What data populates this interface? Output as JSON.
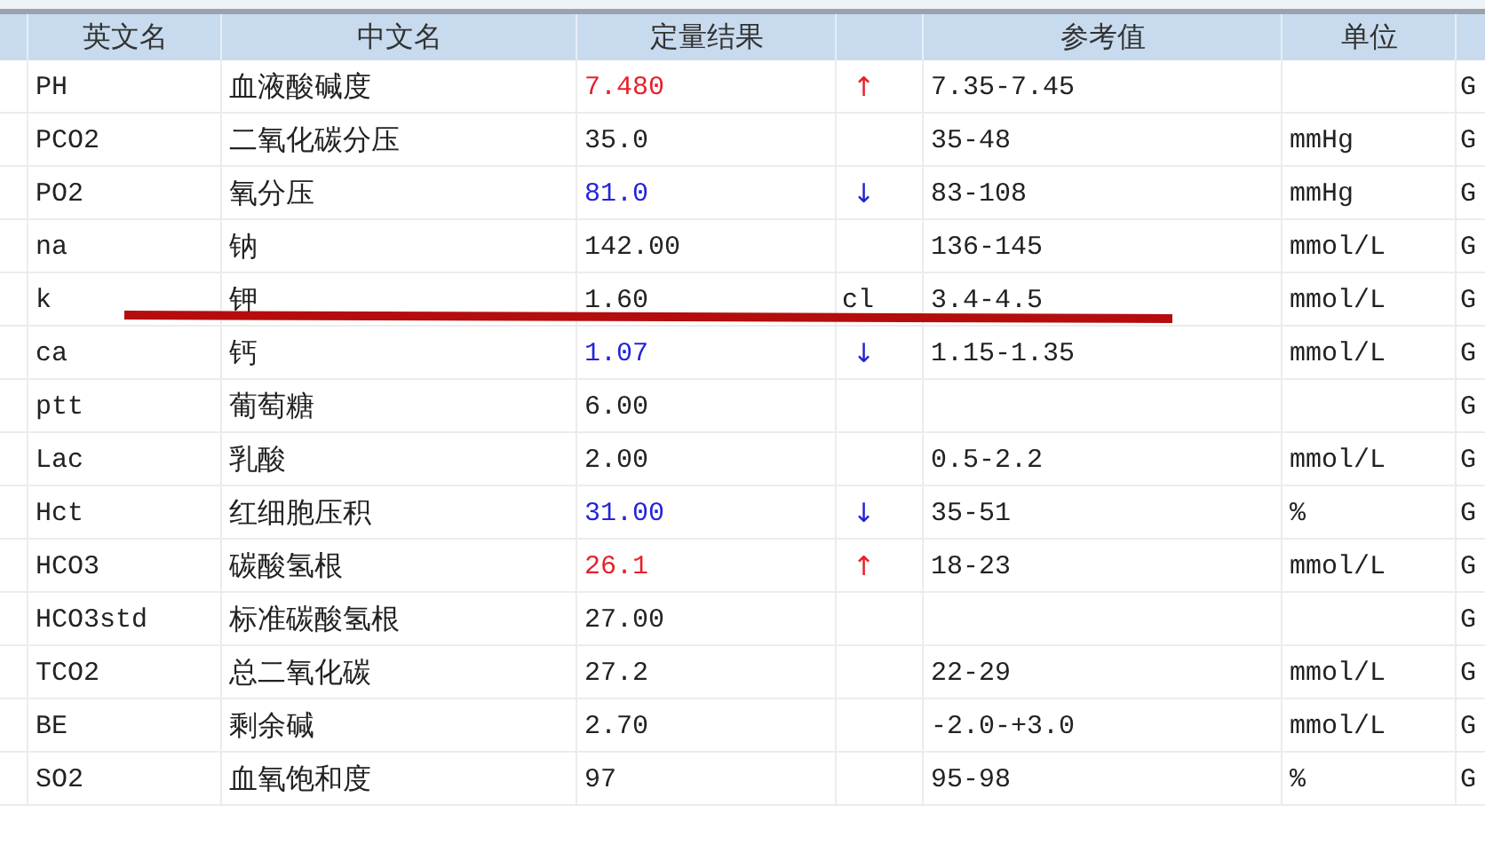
{
  "table": {
    "headers": {
      "english_name": "英文名",
      "chinese_name": "中文名",
      "result": "定量结果",
      "reference": "参考值",
      "unit": "单位"
    },
    "rows": [
      {
        "english_name": "PH",
        "chinese_name": "血液酸碱度",
        "result": "7.480",
        "color": "#e8202a",
        "flag": "↑",
        "reference": "7.35-7.45",
        "column_8": "G"
      },
      {
        "english_name": "PCO2",
        "chinese_name": "二氧化碳分压",
        "result": "35.0",
        "color": "#222222",
        "reference": "35-48",
        "unit": "mmHg",
        "column_8": "G"
      },
      {
        "english_name": "PO2",
        "chinese_name": "氧分压",
        "result": "81.0",
        "color": "#2323d8",
        "flag": "↓",
        "reference": "83-108",
        "unit": "mmHg",
        "column_8": "G"
      },
      {
        "english_name": "na",
        "chinese_name": "钠",
        "result": "142.00",
        "color": "#222222",
        "reference": "136-145",
        "unit": "mmol/L",
        "column_8": "G"
      },
      {
        "english_name": "k",
        "chinese_name": "钾",
        "result": "1.60",
        "color": "#222222",
        "flag": "cl",
        "reference": "3.4-4.5",
        "unit": "mmol/L",
        "column_8": "G"
      },
      {
        "english_name": "ca",
        "chinese_name": "钙",
        "result": "1.07",
        "color": "#2323d8",
        "flag": "↓",
        "reference": "1.15-1.35",
        "unit": "mmol/L",
        "column_8": "G"
      },
      {
        "english_name": "ptt",
        "chinese_name": "葡萄糖",
        "result": "6.00",
        "color": "#222222",
        "column_8": "G"
      },
      {
        "english_name": "Lac",
        "chinese_name": "乳酸",
        "result": "2.00",
        "color": "#222222",
        "reference": "0.5-2.2",
        "unit": "mmol/L",
        "column_8": "G"
      },
      {
        "english_name": "Hct",
        "chinese_name": "红细胞压积",
        "result": "31.00",
        "color": "#2323d8",
        "flag": "↓",
        "reference": "35-51",
        "unit": "%",
        "column_8": "G"
      },
      {
        "english_name": "HCO3",
        "chinese_name": "碳酸氢根",
        "result": "26.1",
        "color": "#e8202a",
        "flag": "↑",
        "reference": "18-23",
        "unit": "mmol/L",
        "column_8": "G"
      },
      {
        "english_name": "HCO3std",
        "chinese_name": "标准碳酸氢根",
        "result": "27.00",
        "color": "#222222",
        "column_8": "G"
      },
      {
        "english_name": "TCO2",
        "chinese_name": "总二氧化碳",
        "result": "27.2",
        "color": "#222222",
        "reference": "22-29",
        "unit": "mmol/L",
        "column_8": "G"
      },
      {
        "english_name": "BE",
        "chinese_name": "剩余碱",
        "result": "2.70",
        "color": "#222222",
        "reference": "-2.0-+3.0",
        "unit": "mmol/L",
        "column_8": "G"
      },
      {
        "english_name": "SO2",
        "chinese_name": "血氧饱和度",
        "result": "97",
        "color": "#222222",
        "reference": "95-98",
        "unit": "%",
        "column_8": "G"
      }
    ]
  }
}
